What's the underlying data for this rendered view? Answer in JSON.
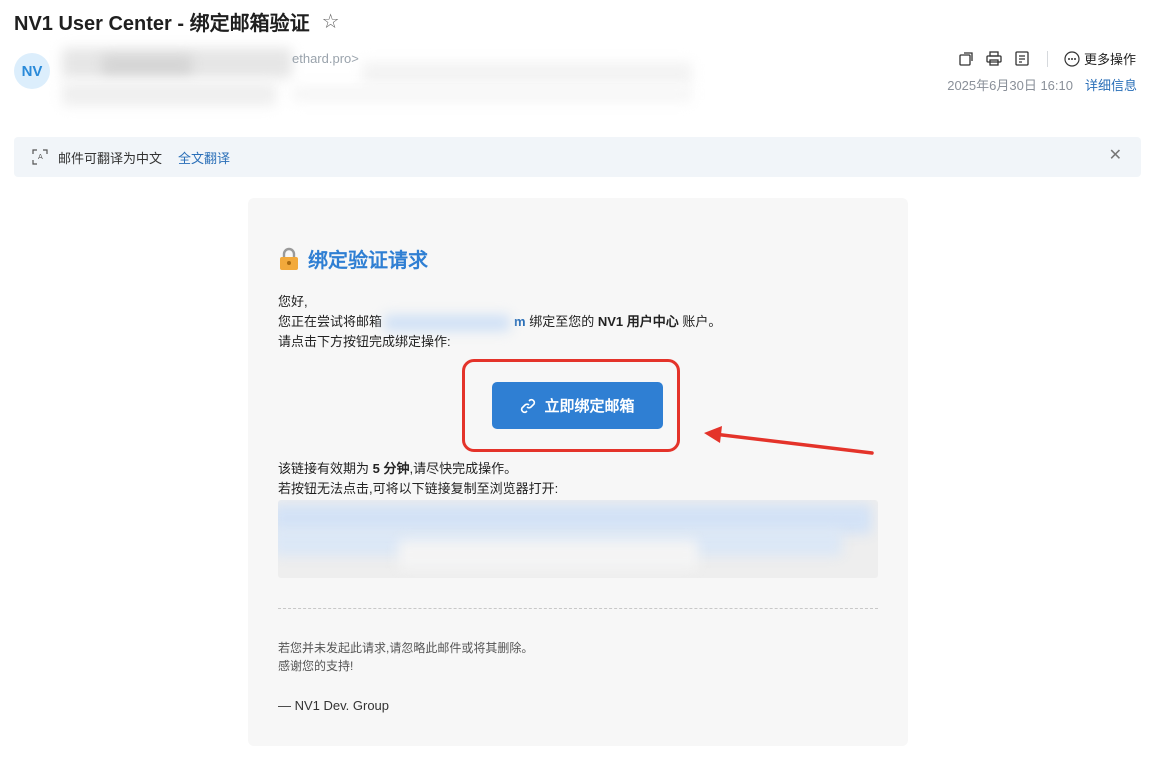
{
  "subject": "NV1 User Center - 绑定邮箱验证",
  "avatar_initials": "NV",
  "sender_visible_fragment": "ethard.pro>",
  "toolbar": {
    "more_label": "更多操作"
  },
  "meta": {
    "datetime": "2025年6月30日 16:10",
    "details_label": "详细信息"
  },
  "translate": {
    "message": "邮件可翻译为中文",
    "link": "全文翻译"
  },
  "email": {
    "title": "绑定验证请求",
    "greeting": "您好,",
    "line2_prefix": "您正在尝试将邮箱",
    "email_tail": "m",
    "line2_mid": " 绑定至您的 ",
    "account_name": "NV1 用户中心",
    "line2_suffix": " 账户。",
    "line3": "请点击下方按钮完成绑定操作:",
    "button_label": "立即绑定邮箱",
    "validity_prefix": "该链接有效期为 ",
    "validity_value": "5 分钟",
    "validity_suffix": ",请尽快完成操作。",
    "fallback": "若按钮无法点击,可将以下链接复制至浏览器打开:",
    "footer1": "若您并未发起此请求,请忽略此邮件或将其删除。",
    "footer2": "感谢您的支持!",
    "signature": "— NV1 Dev. Group"
  },
  "colors": {
    "accent": "#2f7fd3",
    "annotation": "#e4332a"
  }
}
